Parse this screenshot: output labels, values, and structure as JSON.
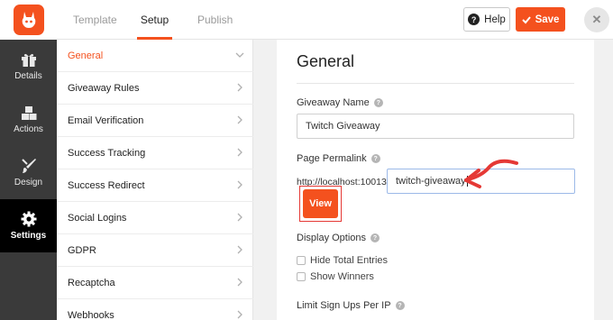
{
  "topbar": {
    "tabs": [
      "Template",
      "Setup",
      "Publish"
    ],
    "help_label": "Help",
    "save_label": "Save",
    "close_symbol": "✕"
  },
  "iconnav": [
    {
      "label": "Details",
      "icon": "gift-icon"
    },
    {
      "label": "Actions",
      "icon": "cubes-icon"
    },
    {
      "label": "Design",
      "icon": "paint-brush-icon"
    },
    {
      "label": "Settings",
      "icon": "gear-icon"
    }
  ],
  "settings_list": [
    "General",
    "Giveaway Rules",
    "Email Verification",
    "Success Tracking",
    "Success Redirect",
    "Social Logins",
    "GDPR",
    "Recaptcha",
    "Webhooks"
  ],
  "main": {
    "title": "General",
    "giveaway_name_label": "Giveaway Name",
    "giveaway_name_value": "Twitch Giveaway",
    "permalink_label": "Page Permalink",
    "permalink_prefix": "http://localhost:10013/",
    "permalink_value": "twitch-giveaway",
    "view_label": "View",
    "display_options_label": "Display Options",
    "hide_entries_label": "Hide Total Entries",
    "show_winners_label": "Show Winners",
    "limit_label": "Limit Sign Ups Per IP",
    "help_symbol": "?"
  },
  "colors": {
    "accent": "#f4511e",
    "sidebar": "#3a3a3a",
    "annotation": "#e53935"
  }
}
